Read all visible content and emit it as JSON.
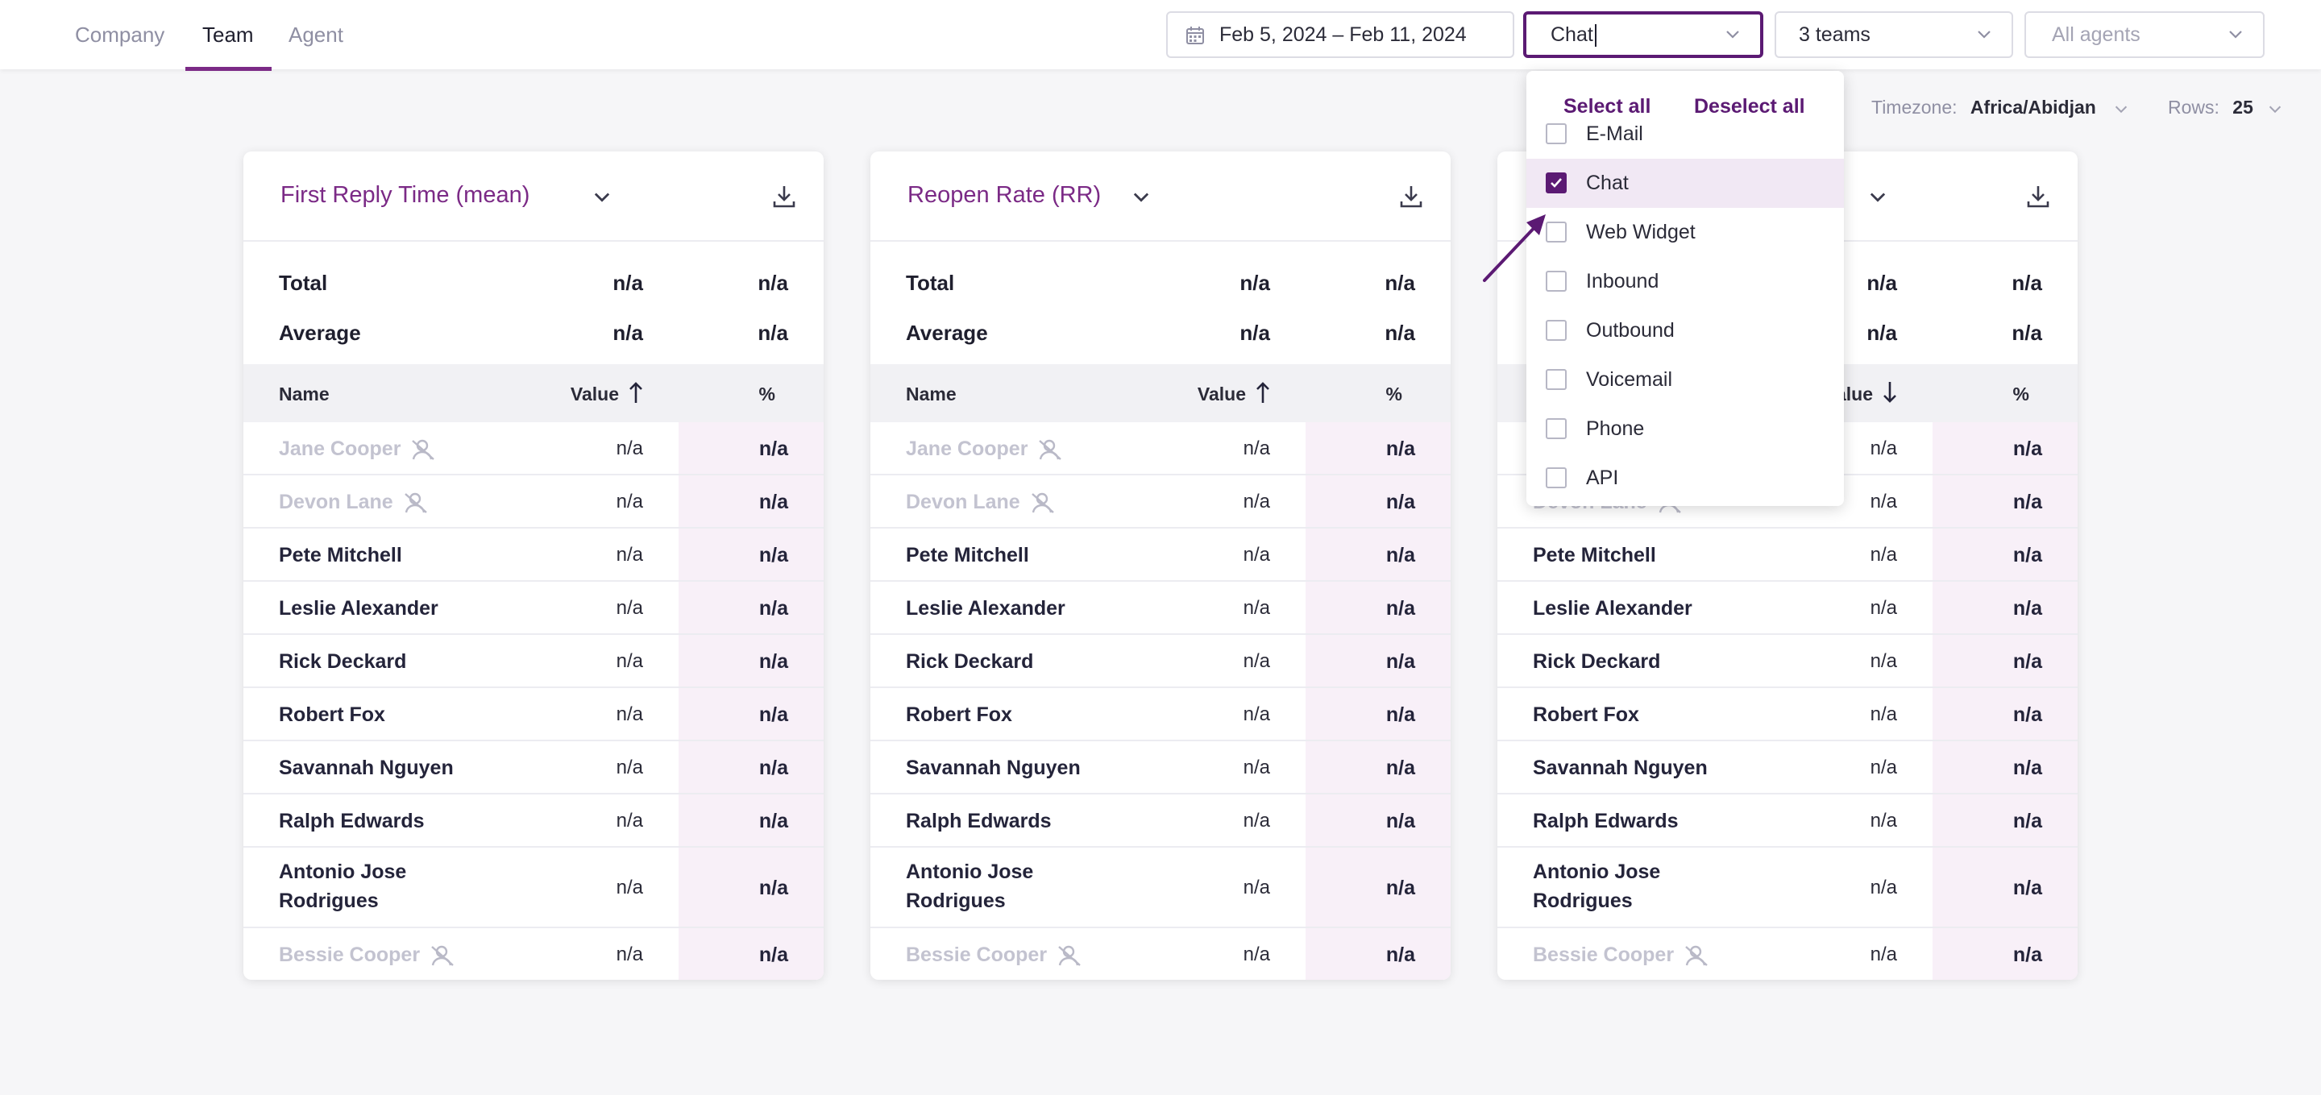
{
  "nav": {
    "tabs": [
      {
        "label": "Company"
      },
      {
        "label": "Team"
      },
      {
        "label": "Agent"
      }
    ]
  },
  "filters": {
    "date_range": "Feb 5, 2024 – Feb 11, 2024",
    "channel_input": "Chat",
    "teams": "3 teams",
    "agents_placeholder": "All agents"
  },
  "meta": {
    "timezone_label": "Timezone:",
    "timezone_value": "Africa/Abidjan",
    "rows_label": "Rows:",
    "rows_value": "25"
  },
  "dropdown": {
    "select_all": "Select all",
    "deselect_all": "Deselect all",
    "options": [
      {
        "label": "E-Mail",
        "checked": false
      },
      {
        "label": "Chat",
        "checked": true
      },
      {
        "label": "Web Widget",
        "checked": false
      },
      {
        "label": "Inbound",
        "checked": false
      },
      {
        "label": "Outbound",
        "checked": false
      },
      {
        "label": "Voicemail",
        "checked": false
      },
      {
        "label": "Phone",
        "checked": false
      },
      {
        "label": "API",
        "checked": false
      }
    ]
  },
  "table_common": {
    "total_label": "Total",
    "average_label": "Average",
    "col_name": "Name",
    "col_value": "Value",
    "col_pct": "%",
    "na": "n/a"
  },
  "cards": [
    {
      "title": "First Reply Time (mean)",
      "sort": "up"
    },
    {
      "title": "Reopen Rate (RR)",
      "sort": "up"
    },
    {
      "title": "",
      "sort": "down"
    }
  ],
  "agents": [
    {
      "name": "Jane Cooper",
      "inactive": true
    },
    {
      "name": "Devon Lane",
      "inactive": true
    },
    {
      "name": "Pete Mitchell",
      "inactive": false
    },
    {
      "name": "Leslie Alexander",
      "inactive": false
    },
    {
      "name": "Rick Deckard",
      "inactive": false
    },
    {
      "name": "Robert Fox",
      "inactive": false
    },
    {
      "name": "Savannah Nguyen",
      "inactive": false
    },
    {
      "name": "Ralph Edwards",
      "inactive": false
    },
    {
      "name": "Antonio Jose Rodrigues",
      "inactive": false
    },
    {
      "name": "Bessie Cooper",
      "inactive": true
    }
  ],
  "colors": {
    "accent": "#7b2a86",
    "accent_dark": "#5b1a73",
    "pct_band": "#f8f0f8"
  },
  "icons": [
    "calendar-icon",
    "chevron-down-icon",
    "download-icon",
    "sort-up-icon",
    "sort-down-icon",
    "user-off-icon",
    "checkbox-check-icon",
    "pointer-arrow-icon"
  ]
}
